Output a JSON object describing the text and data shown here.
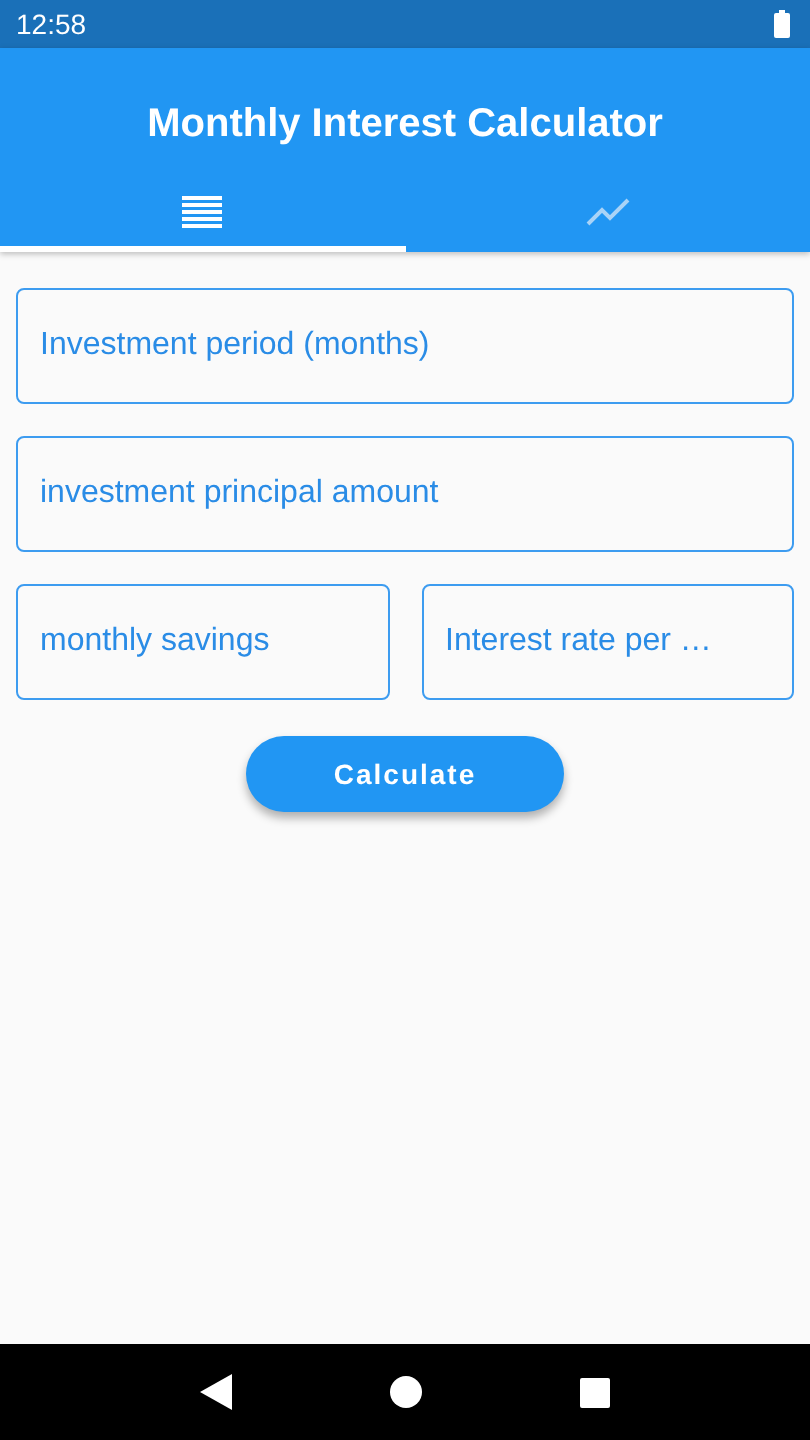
{
  "status_bar": {
    "time": "12:58"
  },
  "app_bar": {
    "title": "Monthly Interest Calculator"
  },
  "tabs": [
    {
      "kind": "list",
      "selected": true
    },
    {
      "kind": "chart",
      "selected": false
    }
  ],
  "field_rows": [
    [
      {
        "placeholder": "Investment period (months)"
      }
    ],
    [
      {
        "placeholder": "investment principal amount"
      }
    ],
    [
      {
        "placeholder": "monthly savings"
      },
      {
        "placeholder": "Interest rate per …"
      }
    ]
  ],
  "button": {
    "label": "Calculate"
  }
}
